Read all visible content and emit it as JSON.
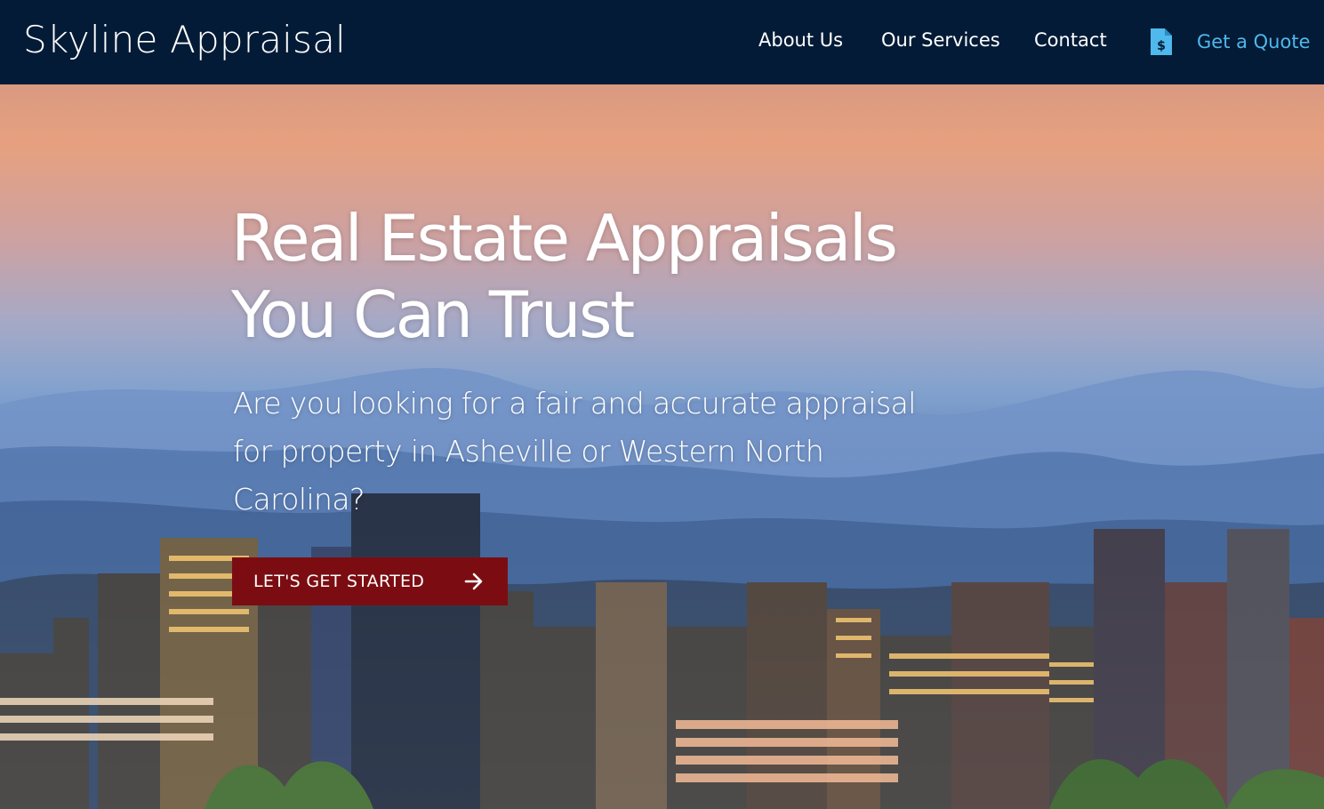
{
  "navbar": {
    "brand": "Skyline Appraisal",
    "links": [
      "About Us",
      "Our Services",
      "Contact"
    ],
    "quote_label": "Get a Quote",
    "quote_icon": "document-dollar-icon",
    "background_color": "#031b36",
    "quote_color": "#4fb8ec"
  },
  "hero": {
    "title_line1": "Real Estate Appraisals",
    "title_line2": "You Can Trust",
    "subtitle": "Are you looking for a fair and accurate appraisal for property in Asheville or Western North Carolina?",
    "cta_label": "LET'S GET STARTED",
    "cta_icon": "arrow-right-icon",
    "cta_color": "#7b0d12",
    "background": "city skyline at dusk with mountains"
  }
}
